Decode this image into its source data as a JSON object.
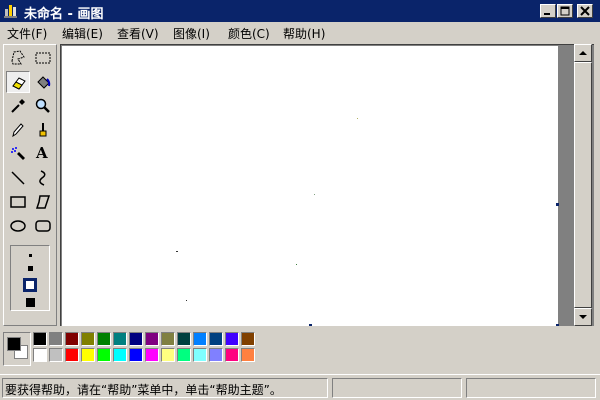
{
  "window": {
    "title": "未命名 - 画图"
  },
  "menu": [
    {
      "label": "文件(F)"
    },
    {
      "label": "编辑(E)"
    },
    {
      "label": "查看(V)"
    },
    {
      "label": "图像(I)"
    },
    {
      "label": "颜色(C)"
    },
    {
      "label": "帮助(H)"
    }
  ],
  "tools": [
    {
      "name": "free-select-icon"
    },
    {
      "name": "rect-select-icon"
    },
    {
      "name": "eraser-icon",
      "selected": true
    },
    {
      "name": "fill-bucket-icon"
    },
    {
      "name": "color-picker-icon"
    },
    {
      "name": "magnifier-icon"
    },
    {
      "name": "pencil-icon"
    },
    {
      "name": "brush-icon"
    },
    {
      "name": "airbrush-icon"
    },
    {
      "name": "text-icon"
    },
    {
      "name": "line-icon"
    },
    {
      "name": "curve-icon"
    },
    {
      "name": "rectangle-icon"
    },
    {
      "name": "polygon-icon"
    },
    {
      "name": "ellipse-icon"
    },
    {
      "name": "rounded-rect-icon"
    }
  ],
  "text_tool_glyph": "A",
  "palette": {
    "foreground": "#000000",
    "background": "#ffffff",
    "row1": [
      "#000000",
      "#808080",
      "#800000",
      "#808000",
      "#008000",
      "#008080",
      "#000080",
      "#800080",
      "#808040",
      "#004040",
      "#0080ff",
      "#004080",
      "#4000ff",
      "#804000"
    ],
    "row2": [
      "#ffffff",
      "#c0c0c0",
      "#ff0000",
      "#ffff00",
      "#00ff00",
      "#00ffff",
      "#0000ff",
      "#ff00ff",
      "#ffff80",
      "#00ff80",
      "#80ffff",
      "#8080ff",
      "#ff0080",
      "#ff8040"
    ]
  },
  "status": {
    "message": "要获得帮助，请在“帮助”菜单中，单击“帮助主题”。"
  }
}
